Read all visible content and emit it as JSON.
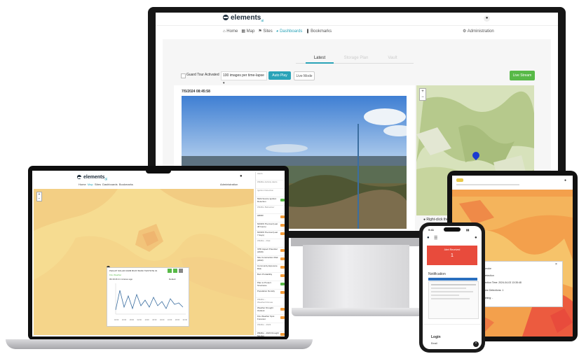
{
  "monitor": {
    "brand": "elements",
    "brand_sub": "ai",
    "nav": [
      "Home",
      "Map",
      "Sites",
      "Dashboards",
      "Bookmarks"
    ],
    "admin": "Administration",
    "tabs": [
      "Latest",
      "Storage Plan",
      "Vault"
    ],
    "guard_tour": "Guard Tour Activated",
    "images_per_page": "100 images per time-lapse",
    "auto_play": "Auto Play",
    "live_mode": "Live Mode",
    "live_stream": "Live Stream",
    "timestamp": "7/5/2024 08:45:58",
    "map_hint": "Right-click the m"
  },
  "laptop": {
    "brand": "elements",
    "brand_sub": "ai",
    "nav": [
      "Home",
      "Map",
      "Sites",
      "Dashboards",
      "Bookmarks"
    ],
    "admin": "Administration",
    "popup_title": "PHILLIP SOLAR FARM BOAT BANK TESTSITE 01",
    "popup_status": "Fire Weather",
    "popup_time": "09:49:46",
    "popup_time_ago": "21 minutes ago",
    "popup_chart_label": "Default",
    "chart_xticks": [
      "02:00",
      "10:00",
      "18:00",
      "02:00",
      "10:00",
      "18:00",
      "02:00",
      "10:00",
      "18:00",
      "02:00"
    ],
    "layers": [
      {
        "label": "Alerts",
        "badge": ""
      },
      {
        "label": "Wildfire Activity Alerts",
        "badge": ""
      },
      {
        "label": "Ignition Detection",
        "badge": ""
      },
      {
        "label": "Multi-Source Ignition Detection",
        "badge": "on"
      },
      {
        "label": "Wildfire Behaviour",
        "badge": ""
      },
      {
        "label": "HRRR",
        "badge": "off"
      },
      {
        "label": "MODIS Thermal (Last 48 hours)",
        "badge": "off"
      },
      {
        "label": "MODIS Thermal (Last 7 days)",
        "badge": "off"
      },
      {
        "label": "Wildfire - Risk",
        "badge": ""
      },
      {
        "label": "VPD Aspect Potential (2020)",
        "badge": "off"
      },
      {
        "label": "Site Construction Risk (2022)",
        "badge": "off"
      },
      {
        "label": "Community Exposure Risk",
        "badge": "off"
      },
      {
        "label": "Burn Probability",
        "badge": "off"
      },
      {
        "label": "Plan to Protect Structures",
        "badge": "on"
      },
      {
        "label": "Population Density",
        "badge": "off"
      },
      {
        "label": "Wildfire - Weather/Climate",
        "badge": ""
      },
      {
        "label": "Weather Drought Outlook",
        "badge": "off"
      },
      {
        "label": "Fire Weather Spot Forecast",
        "badge": "off"
      },
      {
        "label": "Wildfire - 2023",
        "badge": ""
      },
      {
        "label": "Wildfire - 2023 Drought Monitor",
        "badge": "off"
      }
    ]
  },
  "tablet": {
    "popup_lines": [
      "Smoke",
      "Detection",
      "Detection Time: 2024-04-03 13:35:48",
      "Smoke Detections: 1",
      "Lightning: -"
    ]
  },
  "phone": {
    "time": "9:41",
    "alert_title": "Alert Received",
    "alert_count": "1",
    "notification": "Notification",
    "login": "Login",
    "email": "Email"
  },
  "colors": {
    "accent": "#2aa3b8",
    "green": "#58b947",
    "orange": "#f39c3a",
    "alert_red": "#e84b3c",
    "map_yellow": "#f6dc91"
  }
}
